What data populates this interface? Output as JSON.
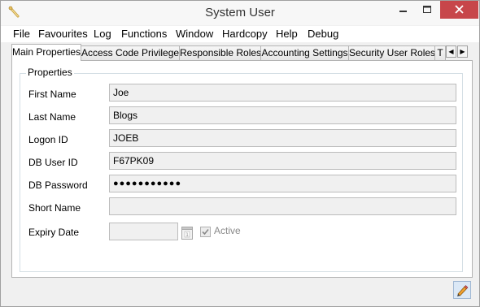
{
  "window": {
    "title": "System User"
  },
  "menu": [
    "File",
    "Favourites",
    "Log",
    "Functions",
    "Window",
    "Hardcopy",
    "Help",
    "Debug"
  ],
  "tabs": [
    "Main Properties",
    "Access Code Privileges",
    "Responsible Roles",
    "Accounting Settings",
    "Security User Roles",
    "T"
  ],
  "properties": {
    "group_label": "Properties",
    "fields": [
      {
        "label": "First Name",
        "value": "Joe"
      },
      {
        "label": "Last Name",
        "value": "Blogs"
      },
      {
        "label": "Logon ID",
        "value": "JOEB"
      },
      {
        "label": "DB User ID",
        "value": "F67PK09"
      },
      {
        "label": "DB Password",
        "value": "●●●●●●●●●●●"
      },
      {
        "label": "Short Name",
        "value": ""
      },
      {
        "label": "Expiry Date",
        "value": ""
      }
    ],
    "active_label": "Active",
    "active_checked": true
  },
  "icons": {
    "app": "wand-icon",
    "edit": "edit-pencil-icon",
    "calendar": "calendar-icon"
  },
  "colors": {
    "close": "#c7464a",
    "field_bg": "#f0f0f0",
    "group_border": "#d5dfe5"
  }
}
